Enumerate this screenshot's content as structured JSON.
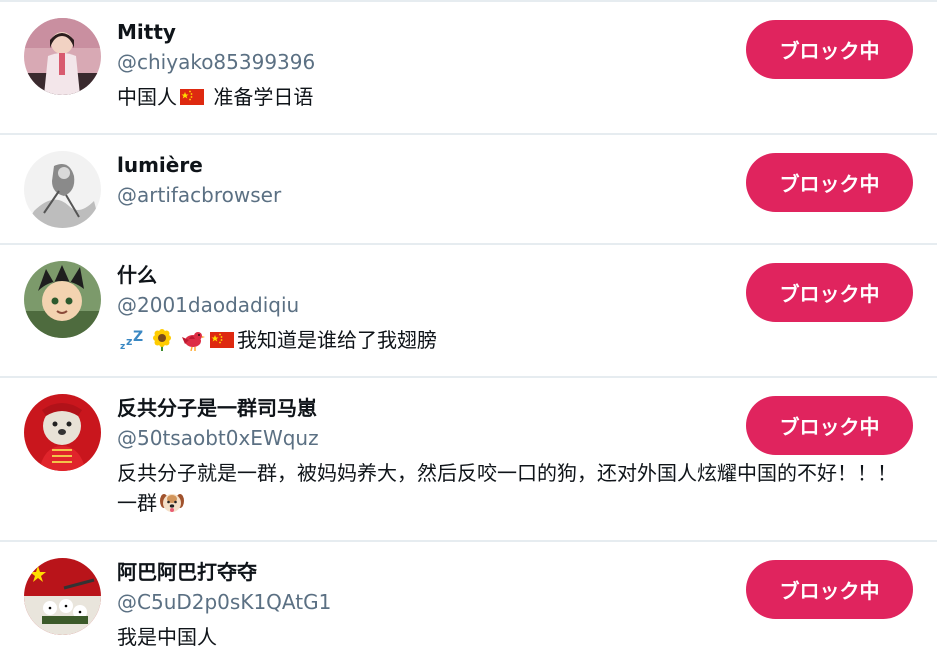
{
  "blocked_users": [
    {
      "name": "Mitty",
      "handle": "@chiyako85399396",
      "bio_before": "中国人",
      "bio_after": " 准备学日语",
      "button_label": "ブロック中"
    },
    {
      "name": "lumière",
      "handle": "@artifacbrowser",
      "bio": "",
      "button_label": "ブロック中"
    },
    {
      "name": "什么",
      "handle": "@2001daodadiqiu",
      "bio_after": "我知道是谁给了我翅膀",
      "button_label": "ブロック中"
    },
    {
      "name": "反共分子是一群司马崽",
      "handle": "@50tsaobt0xEWquz",
      "bio_before": "反共分子就是一群，被妈妈养大，然后反咬一口的狗，还对外国人炫耀中国的不好！！！一群",
      "button_label": "ブロック中"
    },
    {
      "name": "阿巴阿巴打夺夺",
      "handle": "@C5uD2p0sK1QAtG1",
      "bio": "我是中国人",
      "button_label": "ブロック中"
    }
  ],
  "colors": {
    "block_button": "#e0245e",
    "handle": "#5b7083",
    "divider": "#e6ecf0"
  },
  "icons": {
    "flag": "china-flag-icon",
    "zzz": "zzz-icon",
    "sunflower": "sunflower-icon",
    "bird": "bird-icon",
    "dog": "dog-face-icon"
  }
}
